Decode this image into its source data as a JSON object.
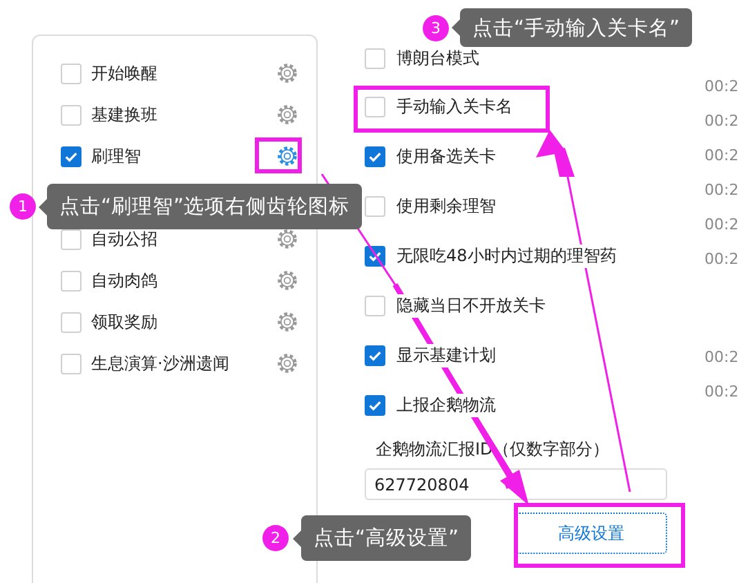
{
  "tasks": [
    {
      "label": "开始唤醒",
      "checked": false
    },
    {
      "label": "基建换班",
      "checked": false
    },
    {
      "label": "刷理智",
      "checked": true
    },
    {
      "kind": "callout",
      "number": "1",
      "text": "点击“刷理智”选项右侧齿轮图标"
    },
    {
      "label": "自动公招",
      "checked": false
    },
    {
      "label": "自动肉鸽",
      "checked": false
    },
    {
      "label": "领取奖励",
      "checked": false
    },
    {
      "label": "生息演算·沙洲遗闻",
      "checked": false
    }
  ],
  "options": [
    {
      "label": "博朗台模式",
      "checked": false
    },
    {
      "label": "手动输入关卡名",
      "checked": false
    },
    {
      "label": "使用备选关卡",
      "checked": true
    },
    {
      "label": "使用剩余理智",
      "checked": false
    },
    {
      "label": "无限吃48小时内过期的理智药",
      "checked": true
    },
    {
      "label": "隐藏当日不开放关卡",
      "checked": false
    },
    {
      "label": "显示基建计划",
      "checked": true
    },
    {
      "label": "上报企鹅物流",
      "checked": true
    }
  ],
  "report_id": {
    "label": "企鹅物流汇报ID（仅数字部分）",
    "value": "627720804"
  },
  "advanced_button": "高级设置",
  "times": [
    "00:2",
    "00:2",
    "00:2",
    "00:2",
    "00:2",
    "00:2",
    "00:2",
    "00:2"
  ],
  "callouts": [
    {
      "number": "2",
      "text": "点击“高级设置”"
    },
    {
      "number": "3",
      "text": "点击“手动输入关卡名”"
    }
  ]
}
